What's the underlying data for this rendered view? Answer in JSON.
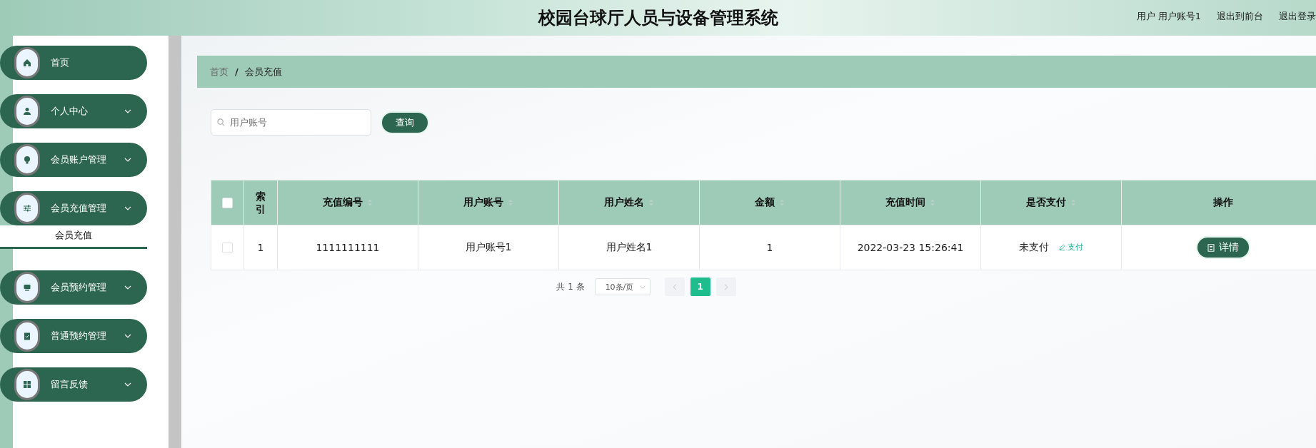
{
  "header": {
    "title": "校园台球厅人员与设备管理系统",
    "user": "用户 用户账号1",
    "links": [
      "退出到前台",
      "退出登录"
    ]
  },
  "sidebar": {
    "items": [
      {
        "label": "首页",
        "selected": false,
        "kind": "link"
      },
      {
        "label": "个人中心",
        "selected": false,
        "kind": "group"
      },
      {
        "label": "会员账户管理",
        "selected": false,
        "kind": "group"
      },
      {
        "label": "会员充值管理",
        "selected": false,
        "kind": "group",
        "expanded": true,
        "children": [
          {
            "label": "会员充值",
            "selected": true
          }
        ]
      },
      {
        "label": "会员预约管理",
        "selected": false,
        "kind": "group"
      },
      {
        "label": "普通预约管理",
        "selected": false,
        "kind": "group"
      },
      {
        "label": "留言反馈",
        "selected": false,
        "kind": "group"
      }
    ]
  },
  "breadcrumb": {
    "items": [
      "首页",
      "会员充值"
    ],
    "separator": "/"
  },
  "search": {
    "placeholder": "用户账号",
    "button": "查询"
  },
  "table": {
    "select_all_checked": false,
    "columns": [
      {
        "label": "索引",
        "sortable": false
      },
      {
        "label": "充值编号",
        "sortable": true
      },
      {
        "label": "用户账号",
        "sortable": true
      },
      {
        "label": "用户姓名",
        "sortable": true
      },
      {
        "label": "金额",
        "sortable": true
      },
      {
        "label": "充值时间",
        "sortable": true
      },
      {
        "label": "是否支付",
        "sortable": true
      },
      {
        "label": "操作",
        "sortable": false
      }
    ],
    "rows": [
      {
        "selected": false,
        "cells": [
          "1",
          "1111111111",
          "用户账号1",
          "用户姓名1",
          "1",
          "2022-03-23 15:26:41",
          "未支付"
        ],
        "pay_link": "支付",
        "action": "详情"
      }
    ]
  },
  "pagination": {
    "total": "共 1 条",
    "page_size": "10条/页",
    "pages": [
      {
        "label": "1",
        "selected": true
      }
    ]
  }
}
